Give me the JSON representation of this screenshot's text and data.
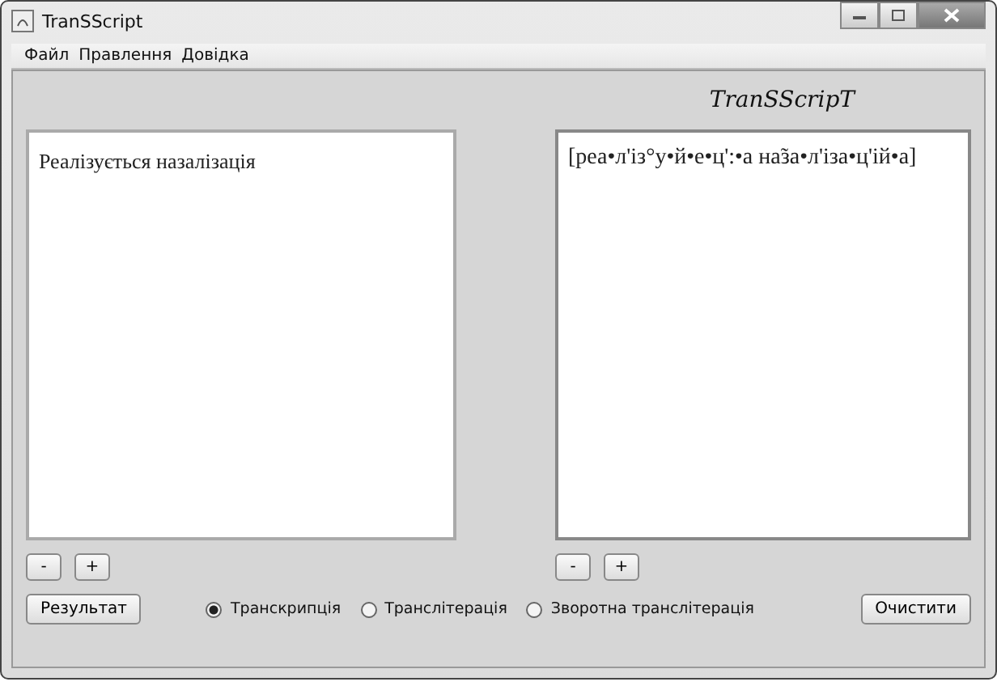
{
  "window": {
    "title": "TranSScript"
  },
  "menu": [
    "Файл",
    "Правлення",
    "Довідка"
  ],
  "logo": "TranSScripT",
  "input_text": "Реалізується назалізація",
  "output_text": "[реа•л'із°у•й•е•ц':•а на̃за•л'іза•ц'ій•а]",
  "left_zoom": [
    "-",
    "+"
  ],
  "right_zoom": [
    "-",
    "+"
  ],
  "result_button": "Результат",
  "modes": [
    {
      "label": "Транскрипція",
      "selected": true
    },
    {
      "label": "Транслітерація",
      "selected": false
    },
    {
      "label": "Зворотна транслітерація",
      "selected": false
    }
  ],
  "clear_button": "Очистити"
}
